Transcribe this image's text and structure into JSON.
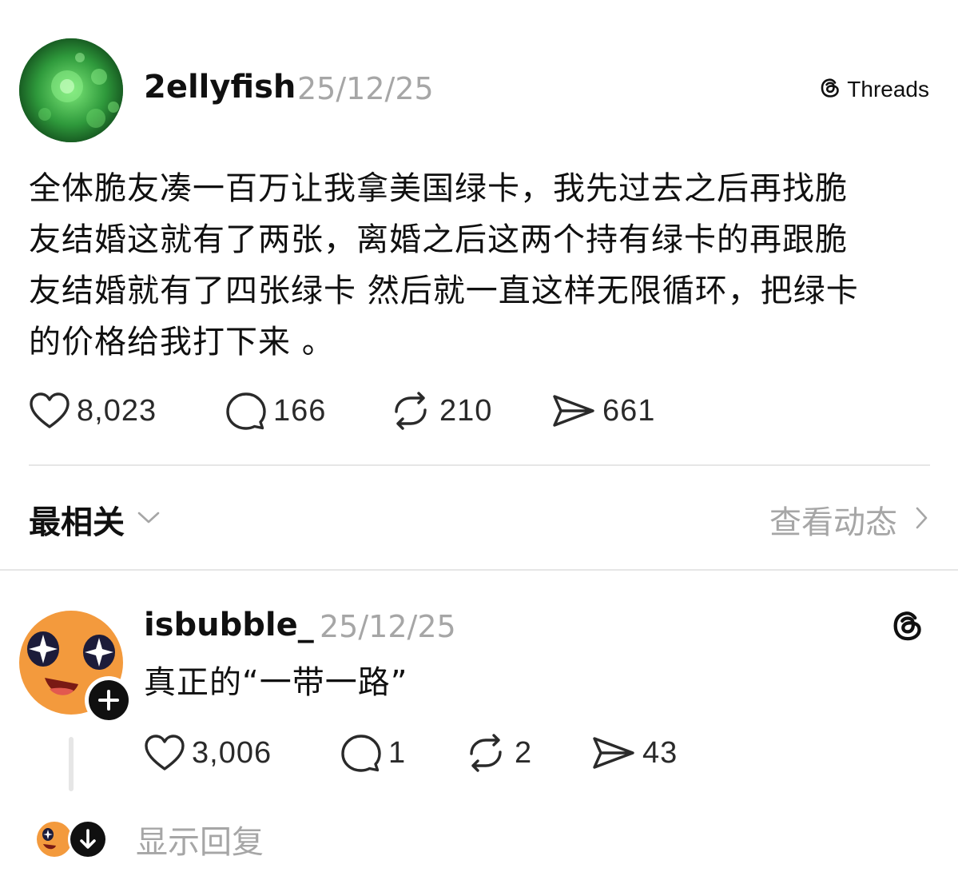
{
  "post": {
    "username": "2ellyfish",
    "date": "25/12/25",
    "brand": "Threads",
    "text_lines": [
      "全体脆友凑一百万让我拿美国绿卡，我先过去之后再找脆",
      "友结婚这就有了两张，离婚之后这两个持有绿卡的再跟脆",
      "友结婚就有了四张绿卡 然后就一直这样无限循环，把绿卡",
      "的价格给我打下来 。"
    ],
    "likes": "8,023",
    "replies": "166",
    "reposts": "210",
    "shares": "661"
  },
  "sort": {
    "label": "最相关",
    "view_activity": "查看动态"
  },
  "reply": {
    "username": "isbubble_",
    "date": "25/12/25",
    "text": "真正的“一带一路”",
    "likes": "3,006",
    "replies": "1",
    "reposts": "2",
    "shares": "43"
  },
  "show_replies": "显示回复",
  "colors": {
    "text": "#101010",
    "muted": "#a6a6a6",
    "divider": "#e6e6e6",
    "avatar_green": "#2f9a3c",
    "avatar_orange": "#f39a3d"
  },
  "icons": [
    "heart-icon",
    "comment-icon",
    "repost-icon",
    "share-icon",
    "threads-logo-icon",
    "chevron-down-icon",
    "chevron-right-icon",
    "plus-icon",
    "arrow-down-icon"
  ]
}
